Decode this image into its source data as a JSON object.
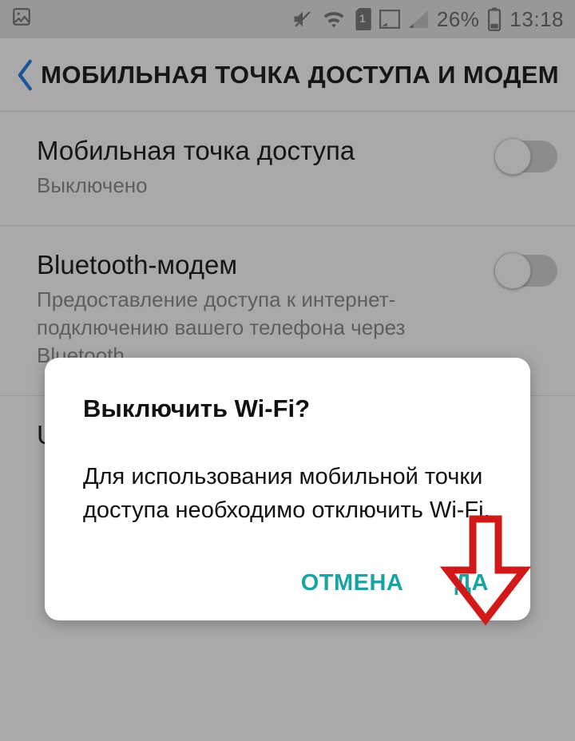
{
  "status": {
    "battery_percent": "26%",
    "time": "13:18",
    "sim_index": "1"
  },
  "header": {
    "title": "МОБИЛЬНАЯ ТОЧКА ДОСТУПА И МОДЕМ"
  },
  "items": [
    {
      "title": "Мобильная точка доступа",
      "sub": "Выключено"
    },
    {
      "title": "Bluetooth-модем",
      "sub": "Предоставление доступа к интернет-подключению вашего телефона через Bluetooth."
    }
  ],
  "partial_item_title_start": "U",
  "dialog": {
    "title": "Выключить Wi-Fi?",
    "body": "Для использования мобильной точки доступа необходимо отключить Wi-Fi.",
    "cancel": "ОТМЕНА",
    "ok": "ДА"
  }
}
